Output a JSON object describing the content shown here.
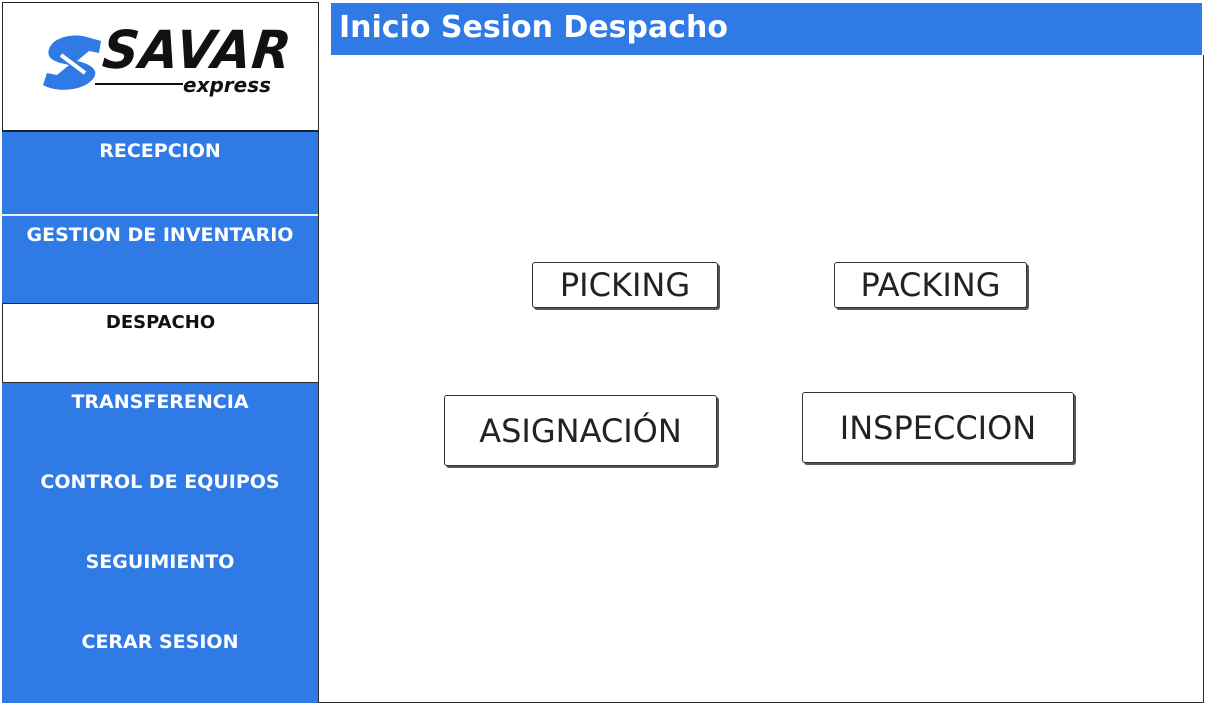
{
  "logo": {
    "brand": "SAVAR",
    "tagline": "express",
    "accent_color": "#2f7ae5"
  },
  "header": {
    "title": "Inicio Sesion Despacho"
  },
  "sidebar": {
    "items": [
      {
        "label": "RECEPCION",
        "active": false
      },
      {
        "label": "GESTION DE INVENTARIO",
        "active": false
      },
      {
        "label": "DESPACHO",
        "active": true
      },
      {
        "label": "TRANSFERENCIA",
        "active": false
      },
      {
        "label": "CONTROL DE EQUIPOS",
        "active": false
      },
      {
        "label": "SEGUIMIENTO",
        "active": false
      },
      {
        "label": "CERAR SESION",
        "active": false
      }
    ]
  },
  "main": {
    "buttons": {
      "picking": "PICKING",
      "packing": "PACKING",
      "asignacion": "ASIGNACIÓN",
      "inspeccion": "INSPECCION"
    }
  },
  "colors": {
    "primary": "#2f7ae5",
    "border": "#2b2b2b",
    "background": "#ffffff"
  }
}
